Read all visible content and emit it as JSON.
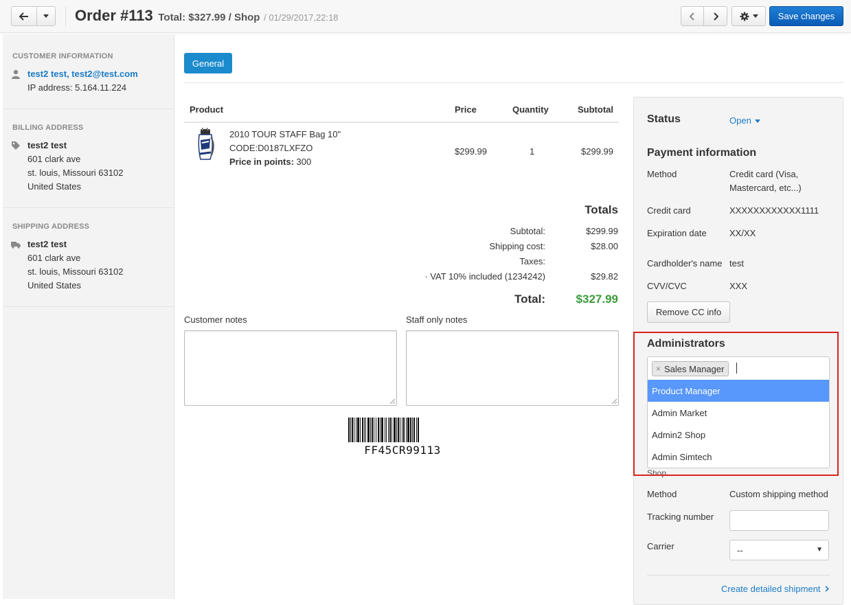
{
  "header": {
    "order_title": "Order #113",
    "order_total": "Total: $327.99 / Shop",
    "order_date": "/ 01/29/2017,22:18",
    "save_label": "Save changes"
  },
  "sidebar": {
    "customer": {
      "heading": "CUSTOMER INFORMATION",
      "name_email": "test2 test, test2@test.com",
      "ip": "IP address: 5.164.11.224"
    },
    "billing": {
      "heading": "BILLING ADDRESS",
      "name": "test2 test",
      "line1": "601 clark ave",
      "line2": "st. louis, Missouri 63102",
      "country": "United States"
    },
    "shipping": {
      "heading": "SHIPPING ADDRESS",
      "name": "test2 test",
      "line1": "601 clark ave",
      "line2": "st. louis, Missouri 63102",
      "country": "United States"
    }
  },
  "main": {
    "tab_general": "General",
    "table": {
      "headers": [
        "Product",
        "Price",
        "Quantity",
        "Subtotal"
      ],
      "rows": [
        {
          "product_name": "2010 TOUR STAFF Bag 10\"",
          "code": "CODE:D0187LXFZO",
          "points_label": "Price in points:",
          "points_value": "300",
          "price": "$299.99",
          "quantity": "1",
          "subtotal": "$299.99"
        }
      ]
    },
    "totals": {
      "title": "Totals",
      "subtotal_label": "Subtotal:",
      "subtotal_value": "$299.99",
      "shipping_label": "Shipping cost:",
      "shipping_value": "$28.00",
      "taxes_label": "Taxes:",
      "vat_label": "· VAT 10% included (1234242)",
      "vat_value": "$29.82",
      "total_label": "Total:",
      "total_value": "$327.99"
    },
    "customer_notes_label": "Customer notes",
    "staff_notes_label": "Staff only notes",
    "barcode_text": "FF45CR99113"
  },
  "right_panel": {
    "status_heading": "Status",
    "status_value": "Open",
    "payment_heading": "Payment information",
    "method_label": "Method",
    "method_value_line1": "Credit card (Visa,",
    "method_value_line2": "Mastercard, etc...)",
    "cc_label": "Credit card",
    "cc_value": "XXXXXXXXXXXX1111",
    "exp_label": "Expiration date",
    "exp_value": "XX/XX",
    "holder_label": "Cardholder's name",
    "holder_value": "test",
    "cvv_label": "CVV/CVC",
    "cvv_value": "XXX",
    "remove_cc_label": "Remove CC info",
    "admins_heading": "Administrators",
    "selected_token": "Sales Manager",
    "dropdown_options": [
      "Product Manager",
      "Admin Market",
      "Admin2 Shop",
      "Admin Simtech"
    ],
    "shop_peek": "Shop",
    "ship_method_label": "Method",
    "ship_method_value": "Custom shipping method",
    "tracking_label": "Tracking number",
    "carrier_label": "Carrier",
    "carrier_value": "--",
    "create_shipment_label": "Create detailed shipment"
  },
  "colors": {
    "accent_blue": "#1a7cc7",
    "save_button": "#0b5cb5",
    "total_green": "#3a9b3a",
    "highlight_red": "#d9231e",
    "dropdown_active": "#5897fb"
  }
}
